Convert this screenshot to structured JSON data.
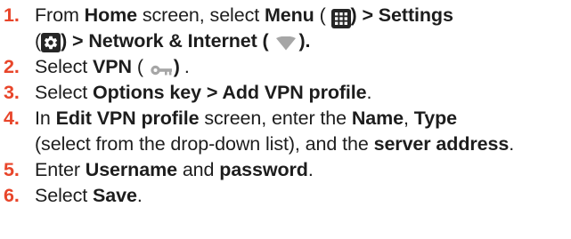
{
  "colors": {
    "accent": "#e8452a",
    "text": "#1d1d1d",
    "icon_dark": "#262626",
    "icon_light": "#a6a6a6"
  },
  "steps": [
    {
      "number": "1.",
      "text": {
        "a": "From",
        "b": "Home",
        "c": "screen, select",
        "d": "Menu",
        "e": "(",
        "f": ") > Settings",
        "g": "(",
        "h": ") > Network & Internet (",
        "i": ")."
      },
      "icons": [
        "grid-menu-icon",
        "settings-gear-icon",
        "wifi-signal-icon"
      ]
    },
    {
      "number": "2.",
      "text": {
        "a": "Select",
        "b": "VPN",
        "c": "(",
        "d": ")",
        "e": "."
      },
      "icons": [
        "vpn-key-icon"
      ]
    },
    {
      "number": "3.",
      "text": {
        "a": "Select",
        "b": "Options key > Add VPN profile",
        "c": "."
      }
    },
    {
      "number": "4.",
      "text": {
        "a": "In",
        "b": "Edit VPN profile",
        "c": "screen, enter the",
        "d": "Name",
        "e": ",",
        "f": "Type",
        "g": "(select from the drop-down list), and the",
        "h": "server address",
        "i": "."
      }
    },
    {
      "number": "5.",
      "text": {
        "a": "Enter",
        "b": "Username",
        "c": "and",
        "d": "password",
        "e": "."
      }
    },
    {
      "number": "6.",
      "text": {
        "a": "Select",
        "b": "Save",
        "c": "."
      }
    }
  ]
}
